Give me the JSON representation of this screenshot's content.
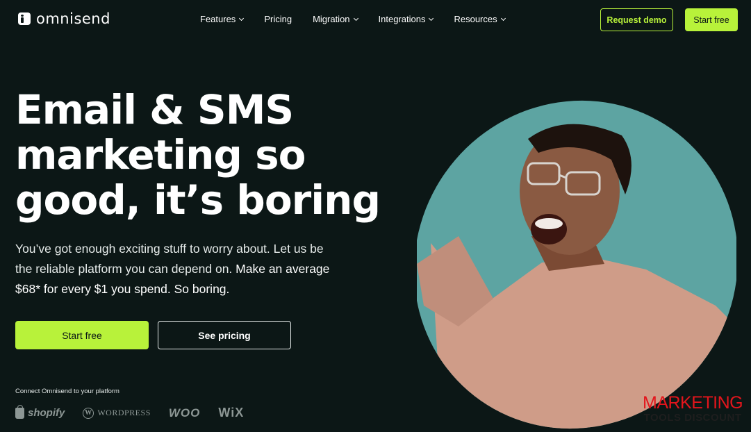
{
  "brand": {
    "name": "omnisend",
    "accent_color": "#b8f23a",
    "background_color": "#0c1716"
  },
  "nav": {
    "items": [
      {
        "label": "Features",
        "has_dropdown": true
      },
      {
        "label": "Pricing",
        "has_dropdown": false
      },
      {
        "label": "Migration",
        "has_dropdown": true
      },
      {
        "label": "Integrations",
        "has_dropdown": true
      },
      {
        "label": "Resources",
        "has_dropdown": true
      }
    ],
    "request_demo_label": "Request demo",
    "start_free_label": "Start free"
  },
  "hero": {
    "headline_line1": "Email & SMS",
    "headline_line2": "marketing so",
    "headline_line3": "good, it’s boring",
    "subtext_part1": "You’ve got enough exciting stuff to worry about. Let us be the reliable platform you can depend on.",
    "subtext_part2": "Make an average $68* for every $1 you spend. So boring.",
    "primary_cta": "Start free",
    "secondary_cta": "See pricing"
  },
  "platforms": {
    "caption": "Connect Omnisend to your platform",
    "logos": [
      {
        "name": "shopify",
        "label": "shopify"
      },
      {
        "name": "wordpress",
        "label": "WORDPRESS"
      },
      {
        "name": "woo",
        "label": "WOO"
      },
      {
        "name": "wix",
        "label": "WiX"
      }
    ]
  },
  "watermark": {
    "line1": "MARKETING",
    "line2": "TOOLS DISCOUNT"
  }
}
